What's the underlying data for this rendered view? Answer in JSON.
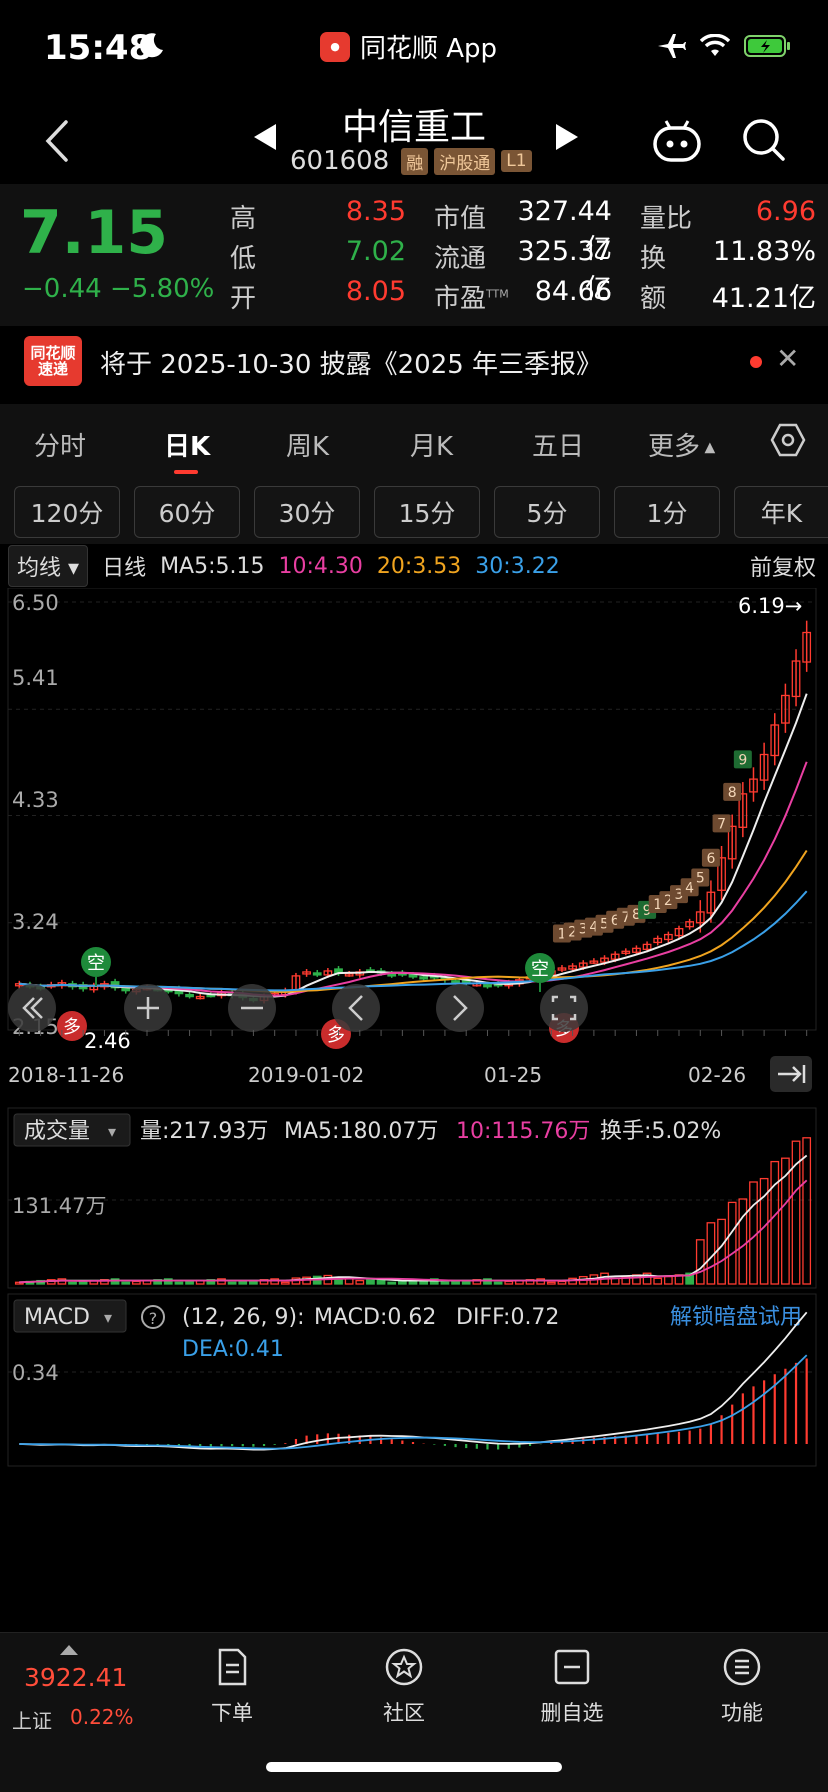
{
  "status": {
    "time": "15:48",
    "app_name": "同花顺 App"
  },
  "header": {
    "stock_name": "中信重工",
    "stock_code": "601608",
    "tags": [
      "融",
      "沪股通",
      "L1"
    ]
  },
  "quote": {
    "price": "7.15",
    "change": "−0.44",
    "change_pct": "−5.80%",
    "high_label": "高",
    "high": "8.35",
    "low_label": "低",
    "low": "7.02",
    "open_label": "开",
    "open": "8.05",
    "mktcap_label": "市值",
    "mktcap": "327.44亿",
    "float_label": "流通",
    "float": "325.37亿",
    "pe_label": "市盈",
    "pe_sup": "TTM",
    "pe": "84.66",
    "volratio_label": "量比",
    "volratio": "6.96",
    "turnover_label": "换",
    "turnover": "11.83%",
    "amount_label": "额",
    "amount": "41.21亿",
    "colors": {
      "up": "#ff3b30",
      "down": "#2fb14a"
    }
  },
  "notice": {
    "logo_top": "同花顺",
    "logo_bottom": "速递",
    "text": "将于 2025-10-30 披露《2025 年三季报》"
  },
  "tabs": [
    "分时",
    "日K",
    "周K",
    "月K",
    "五日",
    "更多"
  ],
  "active_tab": "日K",
  "sub_tabs": [
    "120分",
    "60分",
    "30分",
    "15分",
    "5分",
    "1分",
    "年K"
  ],
  "main_chart": {
    "indicator": "均线",
    "period": "日线",
    "ma5": "MA5:5.15",
    "ma10": "10:4.30",
    "ma20": "20:3.53",
    "ma30": "30:3.22",
    "adjust": "前复权",
    "y_ticks": [
      "6.50",
      "5.41",
      "4.33",
      "3.24",
      "2.15"
    ],
    "max_label": "6.19→",
    "min_label": "2.46",
    "x_ticks": [
      "2018-11-26",
      "2019-01-02",
      "01-25",
      "02-26"
    ],
    "signal_empty": "空",
    "signal_more": "多",
    "td_counts": [
      "1",
      "2",
      "3",
      "4",
      "5",
      "6",
      "7",
      "8",
      "9",
      "1",
      "2",
      "3",
      "4",
      "5",
      "6",
      "7",
      "8",
      "9"
    ]
  },
  "volume_chart": {
    "indicator": "成交量",
    "vol": "量:217.93万",
    "ma5": "MA5:180.07万",
    "ma10": "10:115.76万",
    "turnover": "换手:5.02%",
    "y_tick": "131.47万"
  },
  "macd_chart": {
    "indicator": "MACD",
    "params": "(12, 26, 9):",
    "macd": "MACD:0.62",
    "diff": "DIFF:0.72",
    "dea": "DEA:0.41",
    "unlock": "解锁暗盘试用",
    "y_tick": "0.34"
  },
  "chart_data": {
    "type": "candlestick",
    "title": "中信重工 日K",
    "x_labels": [
      "2018-11-26",
      "2019-01-02",
      "01-25",
      "02-26"
    ],
    "ylim": [
      2.15,
      6.5
    ],
    "moving_averages": {
      "MA5": 5.15,
      "MA10": 4.3,
      "MA20": 3.53,
      "MA30": 3.22
    },
    "max_price": 6.19,
    "min_price": 2.46,
    "closes": [
      2.62,
      2.6,
      2.58,
      2.61,
      2.63,
      2.59,
      2.57,
      2.6,
      2.62,
      2.58,
      2.55,
      2.56,
      2.58,
      2.57,
      2.55,
      2.52,
      2.5,
      2.49,
      2.51,
      2.53,
      2.5,
      2.48,
      2.46,
      2.49,
      2.52,
      2.55,
      2.7,
      2.74,
      2.72,
      2.75,
      2.73,
      2.72,
      2.74,
      2.76,
      2.73,
      2.71,
      2.72,
      2.7,
      2.68,
      2.69,
      2.66,
      2.64,
      2.63,
      2.62,
      2.6,
      2.61,
      2.63,
      2.66,
      2.69,
      2.72,
      2.75,
      2.78,
      2.8,
      2.83,
      2.85,
      2.88,
      2.92,
      2.95,
      2.98,
      3.02,
      3.08,
      3.12,
      3.18,
      3.25,
      3.35,
      3.55,
      3.9,
      4.22,
      4.55,
      4.7,
      4.95,
      5.25,
      5.55,
      5.9,
      6.19
    ],
    "volume": {
      "ylabel": "131.47万",
      "latest": 217.93,
      "ma5": 180.07,
      "ma10": 115.76
    },
    "macd": {
      "macd": 0.62,
      "diff": 0.72,
      "dea": 0.41,
      "tick": 0.34
    }
  },
  "bottom": {
    "index_value": "3922.41",
    "index_name": "上证",
    "index_pct": "0.22%",
    "items": [
      "下单",
      "社区",
      "删自选",
      "功能"
    ]
  }
}
